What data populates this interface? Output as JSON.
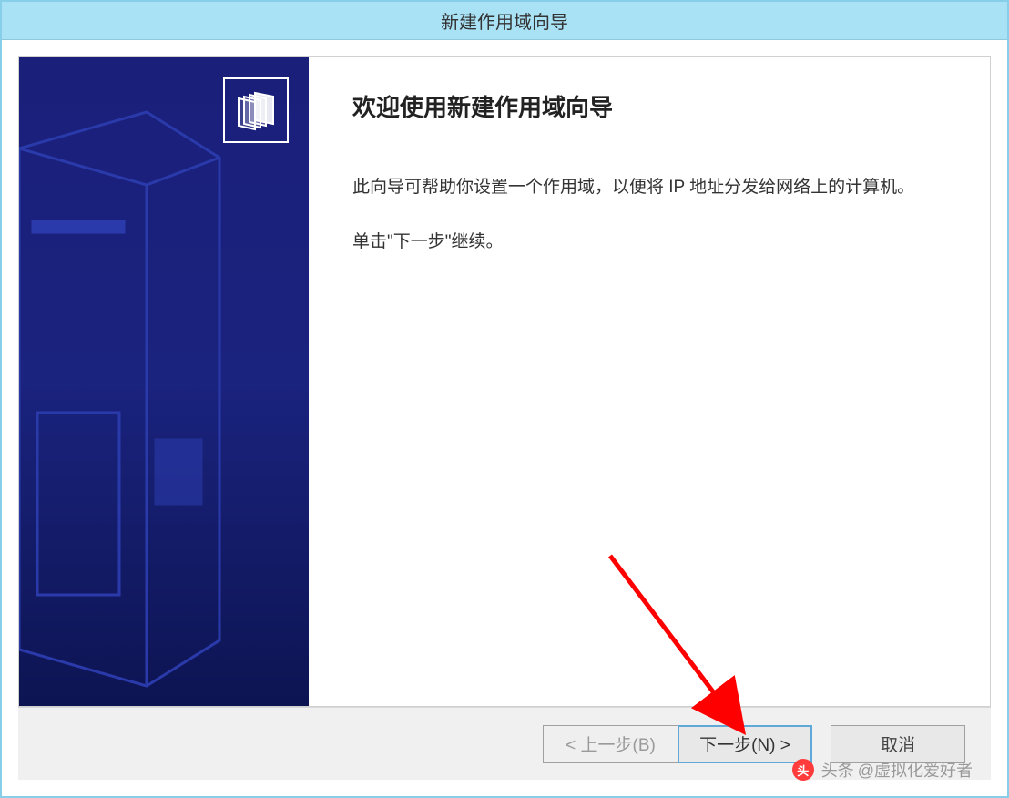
{
  "titlebar": {
    "title": "新建作用域向导"
  },
  "main": {
    "heading": "欢迎使用新建作用域向导",
    "description1": "此向导可帮助你设置一个作用域，以便将 IP 地址分发给网络上的计算机。",
    "description2": "单击\"下一步\"继续。"
  },
  "footer": {
    "back_label": "< 上一步(B)",
    "next_label": "下一步(N) >",
    "cancel_label": "取消"
  },
  "watermark": {
    "prefix": "头条",
    "text": "@虚拟化爱好者"
  }
}
